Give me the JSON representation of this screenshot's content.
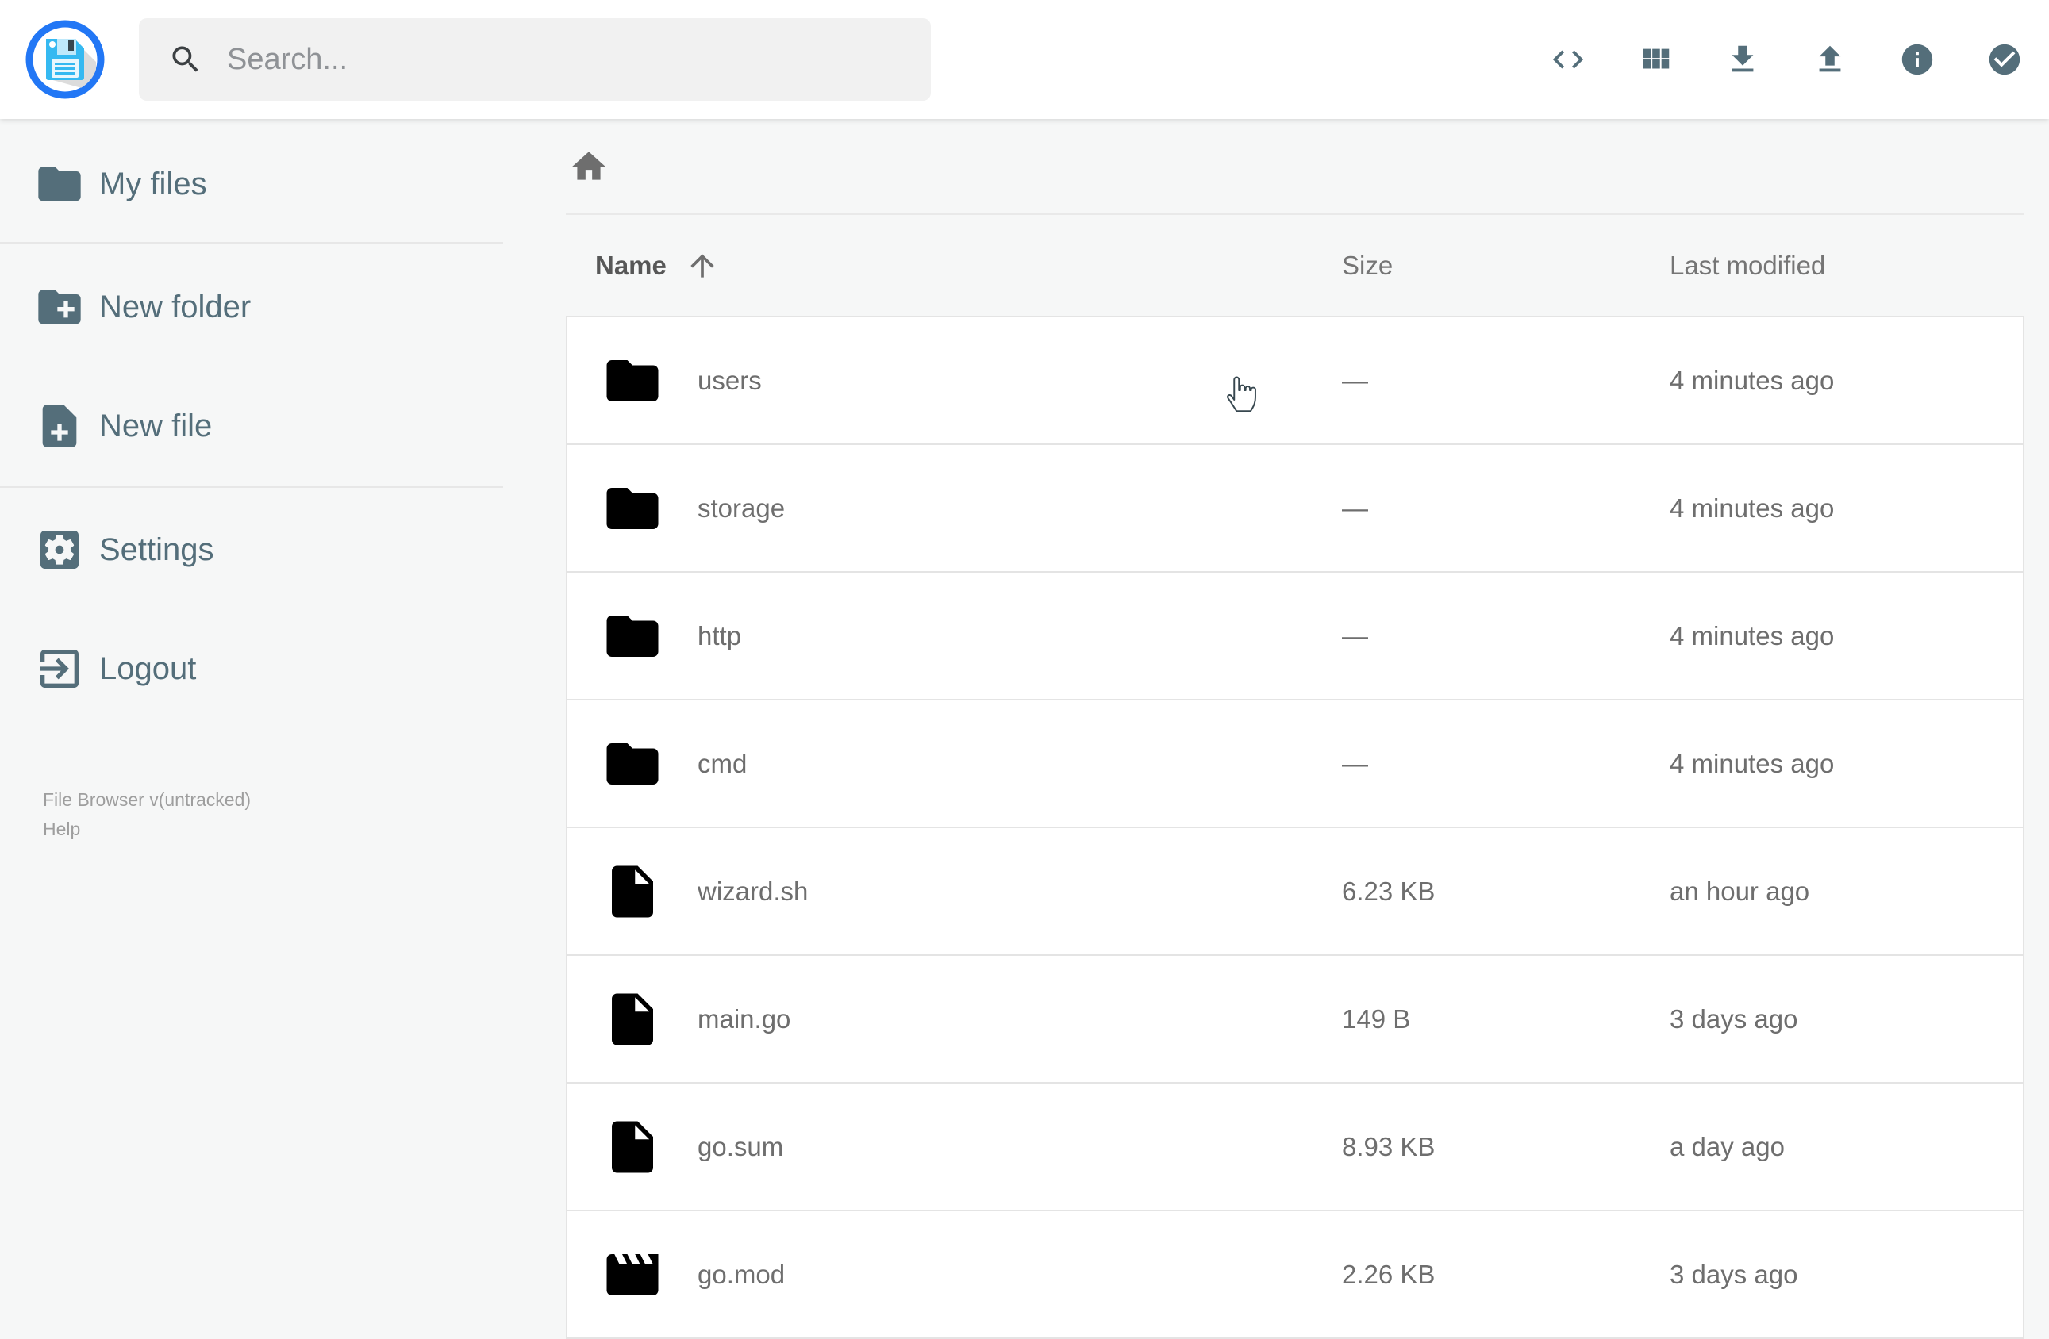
{
  "app": {
    "name": "File Browser"
  },
  "colors": {
    "accent_blue": "#2277f5",
    "slate": "#546e7a",
    "icon_gray": "#6e6e6e",
    "content_bg": "#f6f7f7"
  },
  "header": {
    "search": {
      "placeholder": "Search..."
    },
    "actions": [
      {
        "icon": "code-icon"
      },
      {
        "icon": "grid-view-icon"
      },
      {
        "icon": "download-icon"
      },
      {
        "icon": "upload-icon"
      },
      {
        "icon": "info-icon"
      },
      {
        "icon": "check-circle-icon"
      }
    ]
  },
  "sidebar": {
    "items": [
      {
        "label": "My files",
        "icon": "folder-icon"
      },
      {
        "label": "New folder",
        "icon": "create-folder-icon"
      },
      {
        "label": "New file",
        "icon": "create-file-icon"
      },
      {
        "label": "Settings",
        "icon": "settings-icon"
      },
      {
        "label": "Logout",
        "icon": "logout-icon"
      }
    ],
    "footer": {
      "version": "File Browser v(untracked)",
      "help": "Help"
    }
  },
  "main": {
    "breadcrumb": {
      "icon": "home-icon"
    },
    "columns": {
      "name": "Name",
      "size": "Size",
      "modified": "Last modified"
    },
    "sort": {
      "column": "name",
      "direction": "asc"
    },
    "rows": [
      {
        "name": "users",
        "type": "folder",
        "size": "—",
        "modified": "4 minutes ago"
      },
      {
        "name": "storage",
        "type": "folder",
        "size": "—",
        "modified": "4 minutes ago"
      },
      {
        "name": "http",
        "type": "folder",
        "size": "—",
        "modified": "4 minutes ago"
      },
      {
        "name": "cmd",
        "type": "folder",
        "size": "—",
        "modified": "4 minutes ago"
      },
      {
        "name": "wizard.sh",
        "type": "file",
        "size": "6.23 KB",
        "modified": "an hour ago"
      },
      {
        "name": "main.go",
        "type": "file",
        "size": "149 B",
        "modified": "3 days ago"
      },
      {
        "name": "go.sum",
        "type": "file",
        "size": "8.93 KB",
        "modified": "a day ago"
      },
      {
        "name": "go.mod",
        "type": "movie",
        "size": "2.26 KB",
        "modified": "3 days ago"
      }
    ]
  }
}
